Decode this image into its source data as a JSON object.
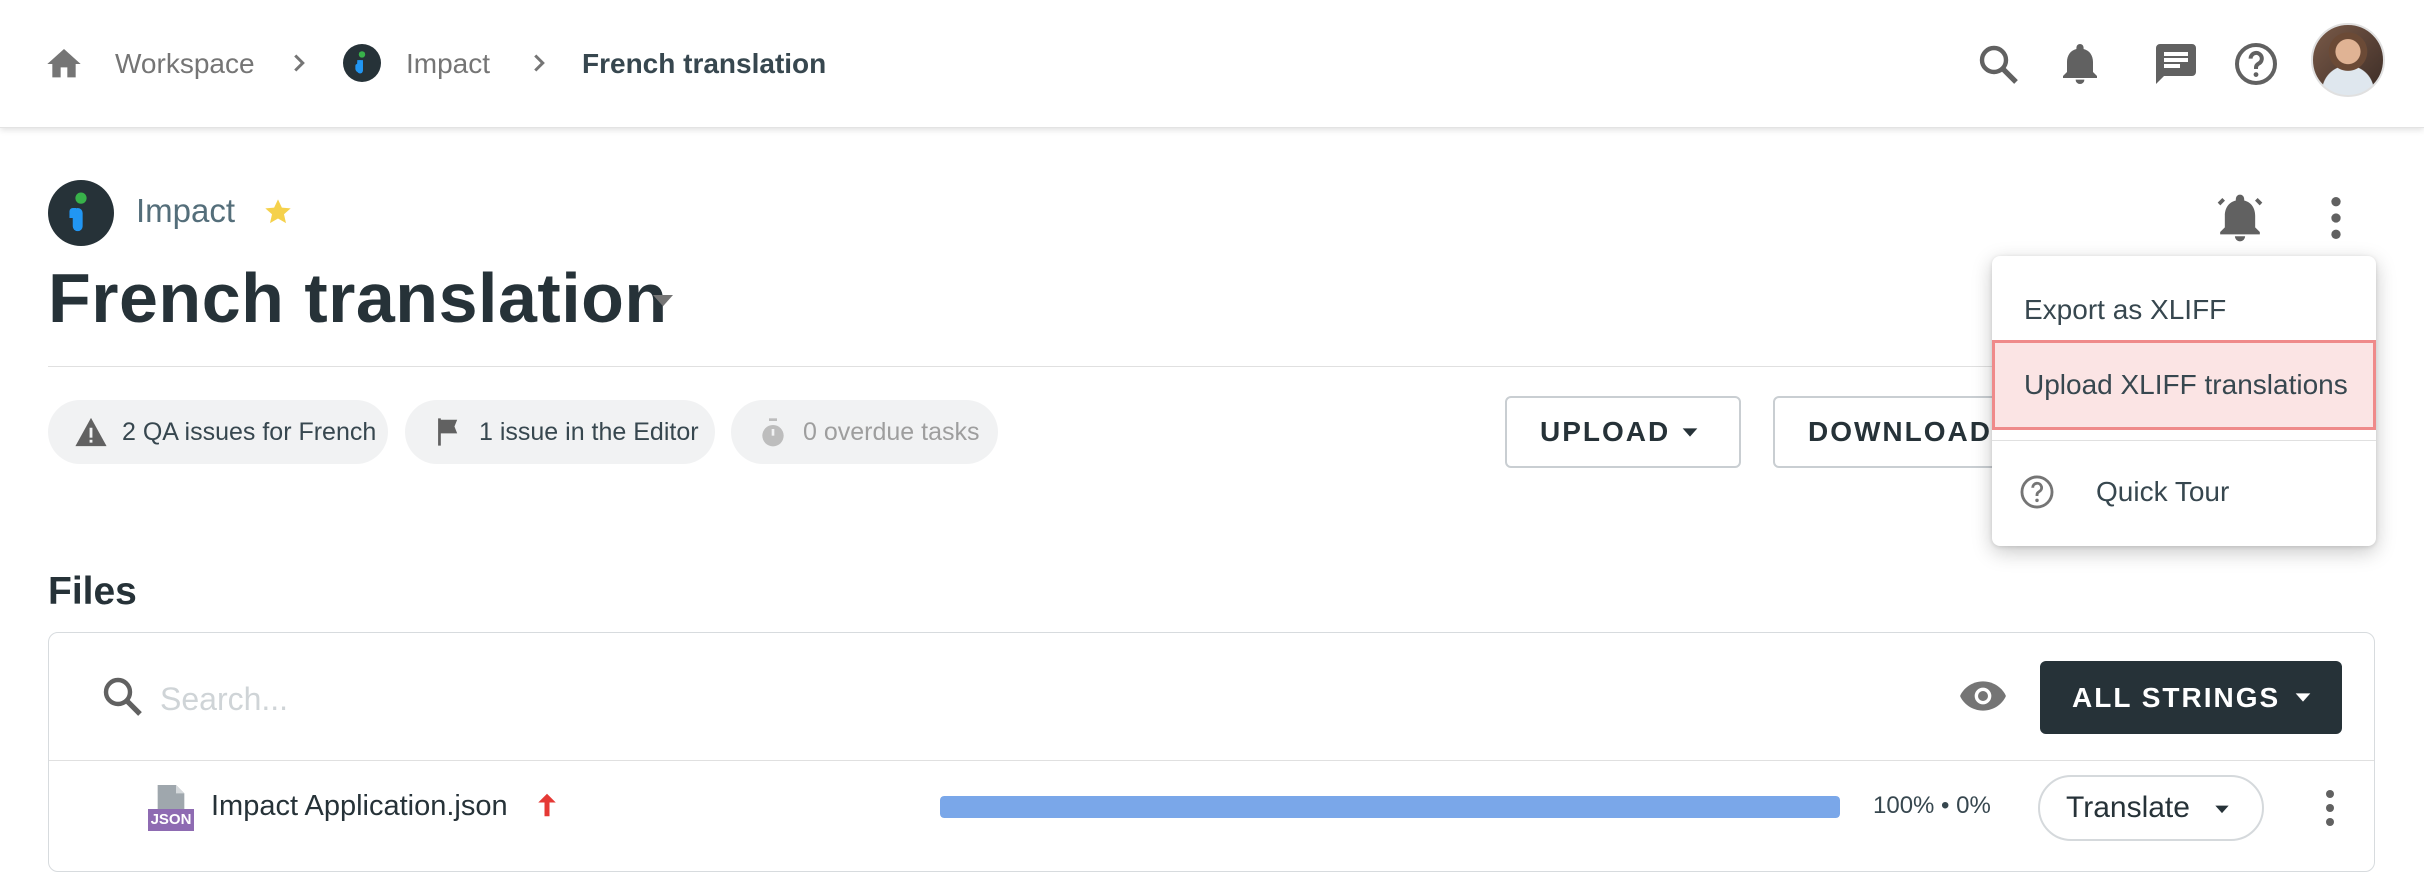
{
  "breadcrumb": {
    "workspace": "Workspace",
    "project": "Impact",
    "current": "French translation"
  },
  "header_icons": [
    "home-icon",
    "chevron-right-icon",
    "search-icon",
    "bell-icon",
    "chat-icon",
    "help-icon",
    "avatar"
  ],
  "project": {
    "name": "Impact",
    "starred": true,
    "title": "French translation"
  },
  "chips": {
    "qa": "2 QA issues for French",
    "editor": "1 issue in the Editor",
    "overdue": "0 overdue tasks"
  },
  "buttons": {
    "upload": "UPLOAD",
    "download": "DOWNLOAD",
    "all_strings": "ALL STRINGS",
    "translate": "Translate"
  },
  "menu": {
    "export": "Export as XLIFF",
    "upload_xliff": "Upload XLIFF translations",
    "quick_tour": "Quick Tour"
  },
  "files": {
    "title": "Files",
    "search_placeholder": "Search...",
    "rows": [
      {
        "type_badge": "JSON",
        "name": "Impact Application.json",
        "progress_text": "100% • 0%",
        "translated_fraction": 1.0
      }
    ]
  },
  "colors": {
    "accent_dark": "#263238",
    "progress": "#7aa7e9",
    "star": "#f5d14b",
    "highlight_border": "#ef8a8a",
    "upload_arrow": "#e53935"
  }
}
